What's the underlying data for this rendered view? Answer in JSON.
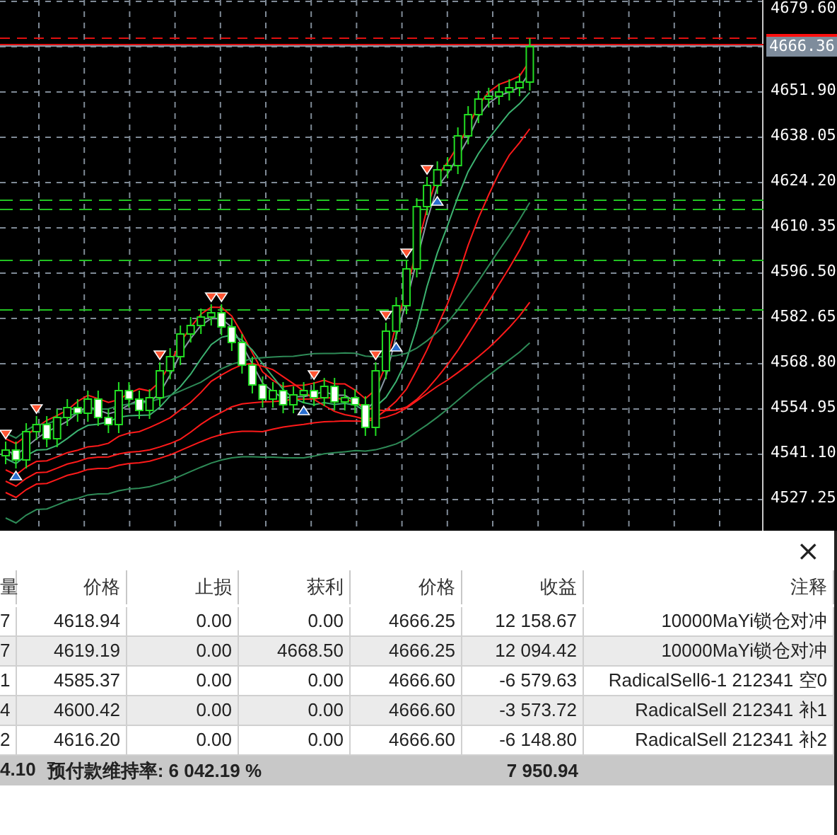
{
  "chart": {
    "price_ticks": [
      "4679.60",
      "4651.90",
      "4638.05",
      "4624.20",
      "4610.35",
      "4596.50",
      "4582.65",
      "4568.80",
      "4554.95",
      "4541.10",
      "4527.25"
    ],
    "current_price": "4666.36"
  },
  "close_label": "×",
  "table": {
    "columns": [
      "量",
      "价格",
      "止损",
      "获利",
      "价格",
      "收益",
      "注释"
    ],
    "rows": [
      {
        "cells": [
          "7",
          "4618.94",
          "0.00",
          "0.00",
          "4666.25",
          "12 158.67",
          "10000MaYi锁仓对冲"
        ]
      },
      {
        "cells": [
          "7",
          "4619.19",
          "0.00",
          "4668.50",
          "4666.25",
          "12 094.42",
          "10000MaYi锁仓对冲"
        ]
      },
      {
        "cells": [
          "1",
          "4585.37",
          "0.00",
          "0.00",
          "4666.60",
          "-6 579.63",
          "RadicalSell6-1 212341 空0"
        ]
      },
      {
        "cells": [
          "4",
          "4600.42",
          "0.00",
          "0.00",
          "4666.60",
          "-3 573.72",
          "RadicalSell 212341 补1"
        ]
      },
      {
        "cells": [
          "2",
          "4616.20",
          "0.00",
          "0.00",
          "4666.60",
          "-6 148.80",
          "RadicalSell 212341 补2"
        ]
      }
    ]
  },
  "summary": {
    "column_1": "4.10",
    "margin_level": "预付款维持率: 6 042.19 %",
    "profit": "7 950.94"
  }
}
